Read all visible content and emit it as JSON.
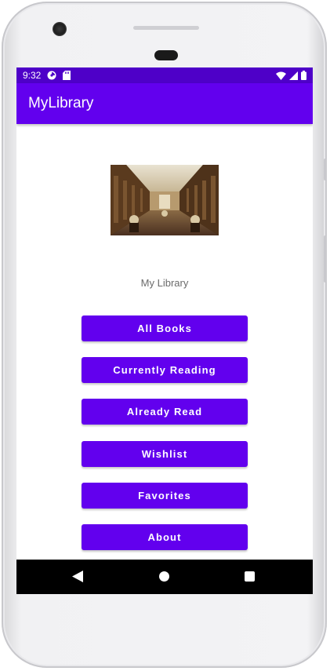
{
  "status_bar": {
    "time": "9:32",
    "left_icons": [
      "data-saver-icon",
      "sd-card-icon"
    ],
    "right_icons": [
      "wifi-icon",
      "signal-icon",
      "battery-icon"
    ],
    "color": "#4e00c8"
  },
  "app_bar": {
    "title": "MyLibrary",
    "color": "#6200ee"
  },
  "main": {
    "image": "library-interior-photo",
    "label": "My Library",
    "buttons": [
      {
        "label": "All Books"
      },
      {
        "label": "Currently Reading"
      },
      {
        "label": "Already Read"
      },
      {
        "label": "Wishlist"
      },
      {
        "label": "Favorites"
      },
      {
        "label": "About"
      }
    ]
  },
  "nav_bar": {
    "icons": [
      "back-icon",
      "home-icon",
      "recents-icon"
    ]
  }
}
